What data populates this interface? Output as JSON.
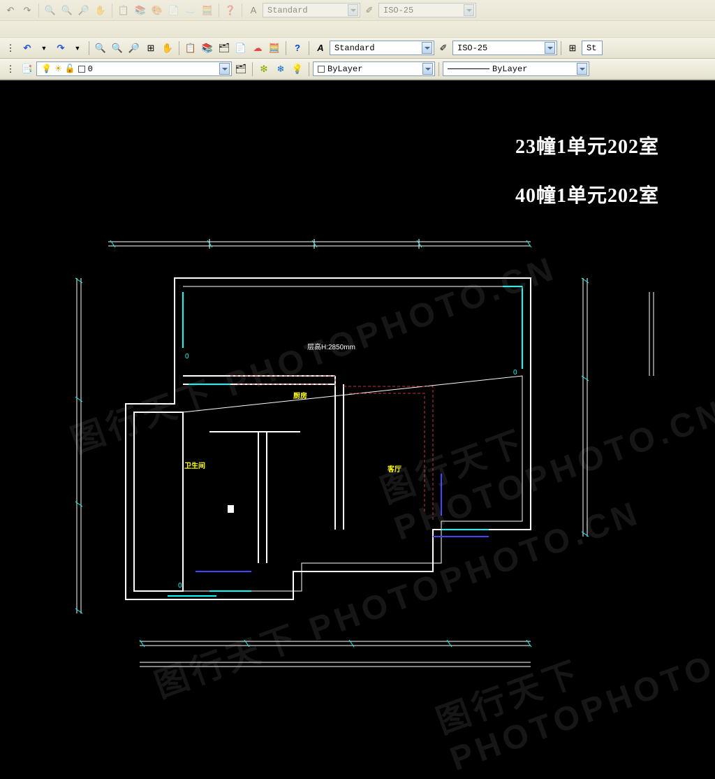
{
  "toolbar": {
    "text_style_label": "Standard",
    "dim_style_label": "ISO-25",
    "text_style_label2": "St",
    "layer_label": "0",
    "color_label": "ByLayer",
    "linetype_label": "ByLayer"
  },
  "drawing": {
    "title1": "23幢1单元202室",
    "title2": "40幢1单元202室",
    "ceiling_note": "层高H:2850mm",
    "room_label_1": "客厅",
    "room_label_2": "厨房",
    "room_label_3": "卫生间",
    "zero_marker": "0"
  },
  "watermark": "图行天下 PHOTOPHOTO.CN"
}
